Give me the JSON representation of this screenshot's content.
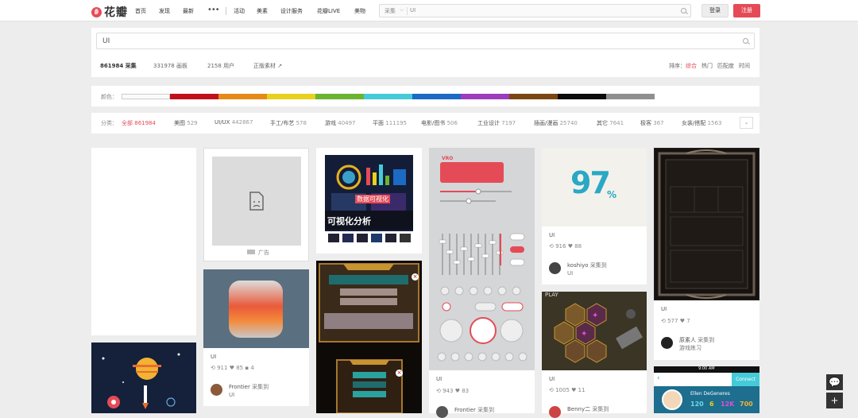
{
  "header": {
    "logo": "花瓣",
    "nav": [
      "首页",
      "发现",
      "最新",
      "活动",
      "美素",
      "设计服务",
      "花瓣LIVE",
      "美物"
    ],
    "search_category": "采集",
    "search_value": "UI",
    "login": "登录",
    "register": "注册"
  },
  "search": {
    "value": "UI",
    "tabs": [
      {
        "count": "861984",
        "label": "采集"
      },
      {
        "count": "331978",
        "label": "画板"
      },
      {
        "count": "2158",
        "label": "用户"
      },
      {
        "label": "正版素材"
      }
    ],
    "sort_label": "排序：",
    "sort": [
      "综合",
      "热门",
      "匹配度",
      "时间"
    ]
  },
  "colors": {
    "label": "颜色：",
    "swatches": [
      "#fafafa",
      "#c1101d",
      "#e58a17",
      "#e7d01e",
      "#6bb431",
      "#45cbd8",
      "#1c6ac3",
      "#9d3cbc",
      "#7b4614",
      "#0c0c0c",
      "#8f8f8f"
    ]
  },
  "categories": {
    "label": "分类：",
    "items": [
      {
        "name": "全部",
        "count": "861984"
      },
      {
        "name": "美图",
        "count": "529"
      },
      {
        "name": "UI/UX",
        "count": "442867"
      },
      {
        "name": "手工/布艺",
        "count": "578"
      },
      {
        "name": "游戏",
        "count": "40497"
      },
      {
        "name": "平面",
        "count": "111195"
      },
      {
        "name": "电影/图书",
        "count": "506"
      },
      {
        "name": "工业设计",
        "count": "7197"
      },
      {
        "name": "插画/漫画",
        "count": "25740"
      },
      {
        "name": "其它",
        "count": "7641"
      },
      {
        "name": "极客",
        "count": "367"
      },
      {
        "name": "女装/搭配",
        "count": "1563"
      }
    ]
  },
  "pins": {
    "ad": {
      "tag": "广告"
    },
    "infographic": {
      "text": "可视化分析",
      "sub": "数据可视化"
    },
    "cube": {
      "caption": "UI",
      "repins": "911",
      "likes": "85",
      "comments": "4",
      "user": "Frontier",
      "via": "采集到",
      "board": "UI"
    },
    "percent": {
      "number": "97",
      "unit": "%",
      "caption": "UI",
      "repins": "916",
      "likes": "88",
      "user": "koshiyo",
      "via": "采集到",
      "board": "UI"
    },
    "mixer": {
      "title": "VRO",
      "caption": "UI",
      "repins": "943",
      "likes": "83",
      "user": "Frontier",
      "via": "采集到"
    },
    "hex": {
      "label": "PLAY",
      "caption": "UI",
      "repins": "1005",
      "likes": "11",
      "user": "Benny二",
      "via": "采集到"
    },
    "frame": {
      "caption": "UI",
      "repins": "577",
      "likes": "7",
      "user": "原素人",
      "via": "采集到",
      "board": "游戏练习"
    },
    "phone": {
      "time": "9:00 AM",
      "connect": "Connect",
      "name": "Ellen DeGeneres",
      "stats": [
        "120",
        "6",
        "12K",
        "700"
      ]
    }
  },
  "float": {
    "feedback": "💬",
    "plus": "+"
  }
}
